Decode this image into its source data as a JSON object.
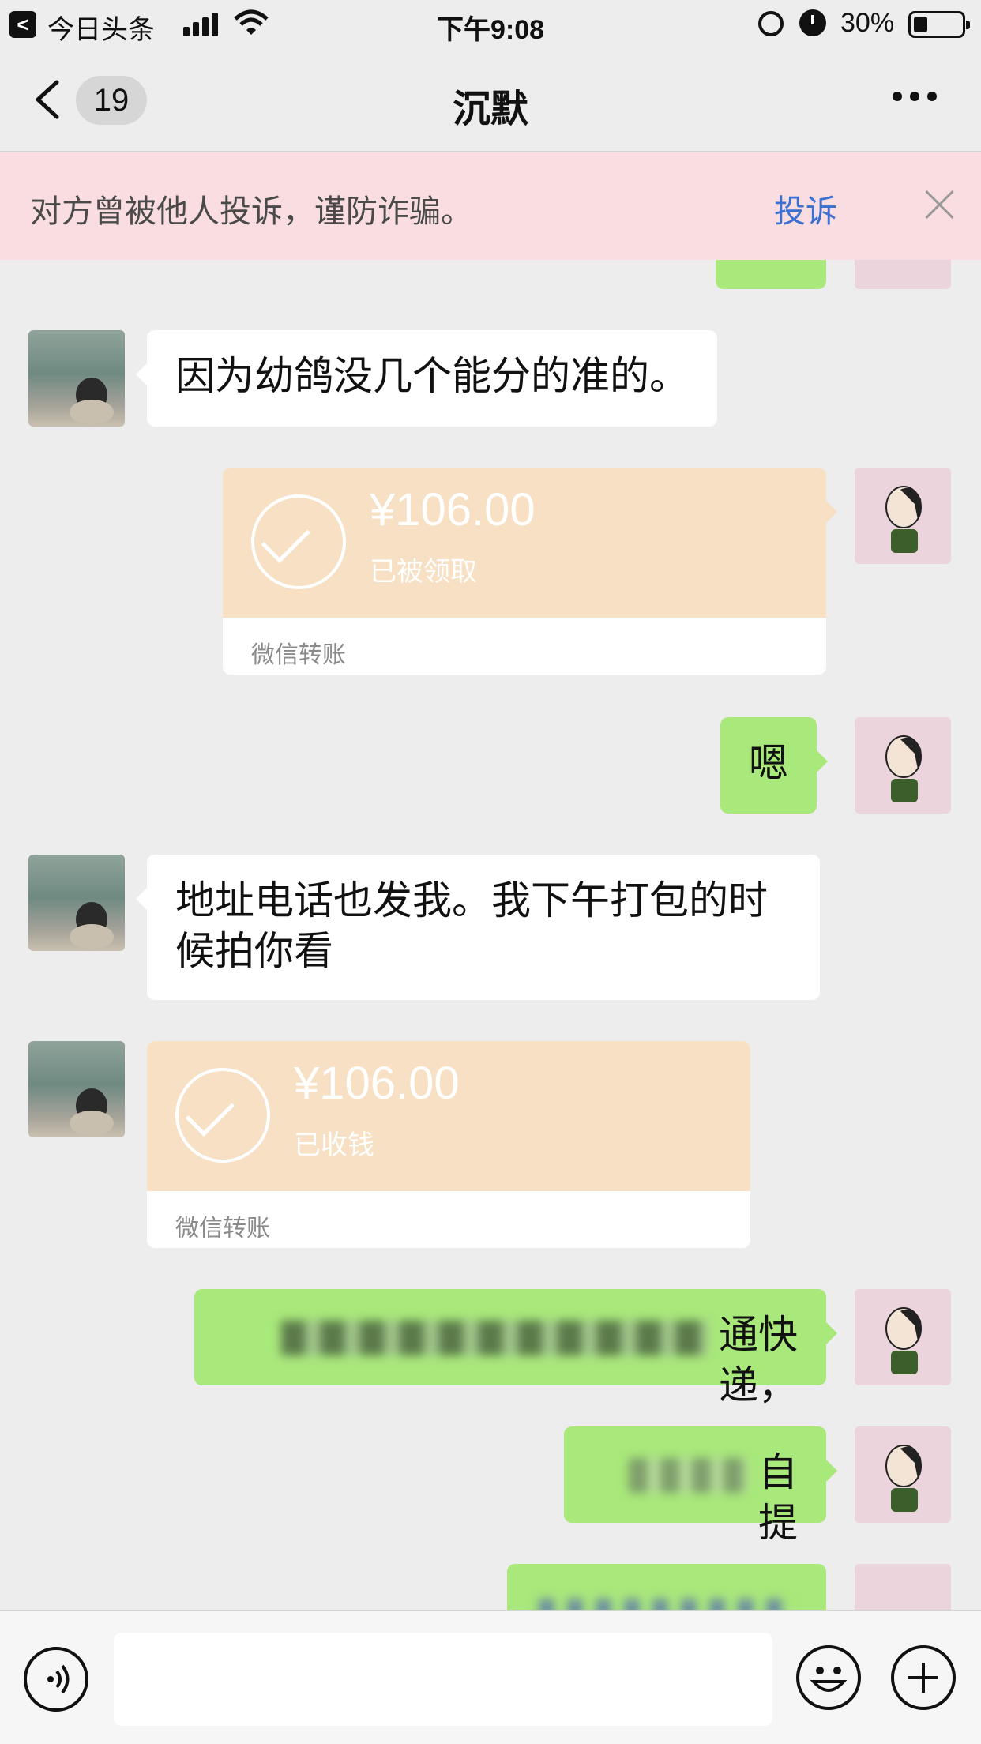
{
  "status_bar": {
    "back_app": "今日头条",
    "time": "下午9:08",
    "battery": "30%",
    "battery_level": 0.3
  },
  "nav": {
    "unread_count": "19",
    "title": "沉默",
    "more_icon": "more-icon"
  },
  "banner": {
    "text": "对方曾被他人投诉，谨防诈骗。",
    "link": "投诉"
  },
  "messages": [
    {
      "side": "them",
      "type": "text",
      "text": "因为幼鸽没几个能分的准的。"
    },
    {
      "side": "me",
      "type": "transfer",
      "amount": "¥106.00",
      "status": "已被领取",
      "label": "微信转账"
    },
    {
      "side": "me",
      "type": "text",
      "text": "嗯"
    },
    {
      "side": "them",
      "type": "text",
      "line1": "地址电话也发我。我下午打包的时",
      "line2": "候拍你看"
    },
    {
      "side": "them",
      "type": "transfer",
      "amount": "¥106.00",
      "status": "已收钱",
      "label": "微信转账"
    },
    {
      "side": "me",
      "type": "text",
      "text": "通快递，"
    },
    {
      "side": "me",
      "type": "text",
      "text": "自提"
    }
  ]
}
